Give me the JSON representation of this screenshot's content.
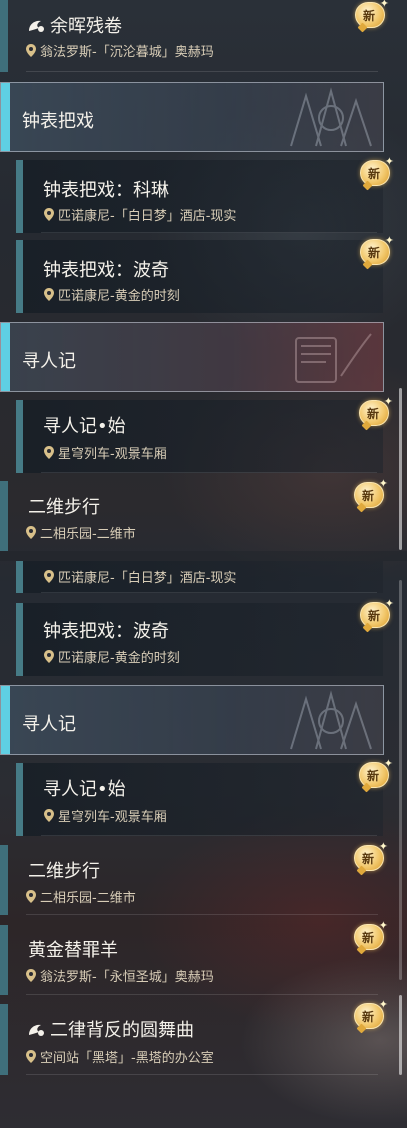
{
  "badge_label": "新",
  "panel_a": {
    "top_item": {
      "title": "余晖残卷",
      "location": "翁法罗斯-「沉沦暮城」奥赫玛"
    },
    "category_1": {
      "title": "钟表把戏"
    },
    "sub_1": {
      "title": "钟表把戏：科琳",
      "location": "匹诺康尼-「白日梦」酒店-现实"
    },
    "sub_2": {
      "title": "钟表把戏：波奇",
      "location": "匹诺康尼-黄金的时刻"
    },
    "category_2": {
      "title": "寻人记"
    },
    "sub_3": {
      "title": "寻人记•始",
      "location": "星穹列车-观景车厢"
    },
    "item_2": {
      "title": "二维步行",
      "location": "二相乐园-二维市"
    }
  },
  "panel_b": {
    "partial_loc": "匹诺康尼-「白日梦」酒店-现实",
    "sub_2": {
      "title": "钟表把戏：波奇",
      "location": "匹诺康尼-黄金的时刻"
    },
    "category_2": {
      "title": "寻人记"
    },
    "sub_3": {
      "title": "寻人记•始",
      "location": "星穹列车-观景车厢"
    },
    "item_2": {
      "title": "二维步行",
      "location": "二相乐园-二维市"
    },
    "item_3": {
      "title": "黄金替罪羊",
      "location": "翁法罗斯-「永恒圣城」奥赫玛"
    },
    "item_4": {
      "title": "二律背反的圆舞曲",
      "location": "空间站「黑塔」-黑塔的办公室"
    }
  },
  "colors": {
    "accent_main": "#3f6f7b",
    "accent_category": "#5fcfe3",
    "badge": "#f2c86c",
    "location_text": "#d8cdb7"
  }
}
